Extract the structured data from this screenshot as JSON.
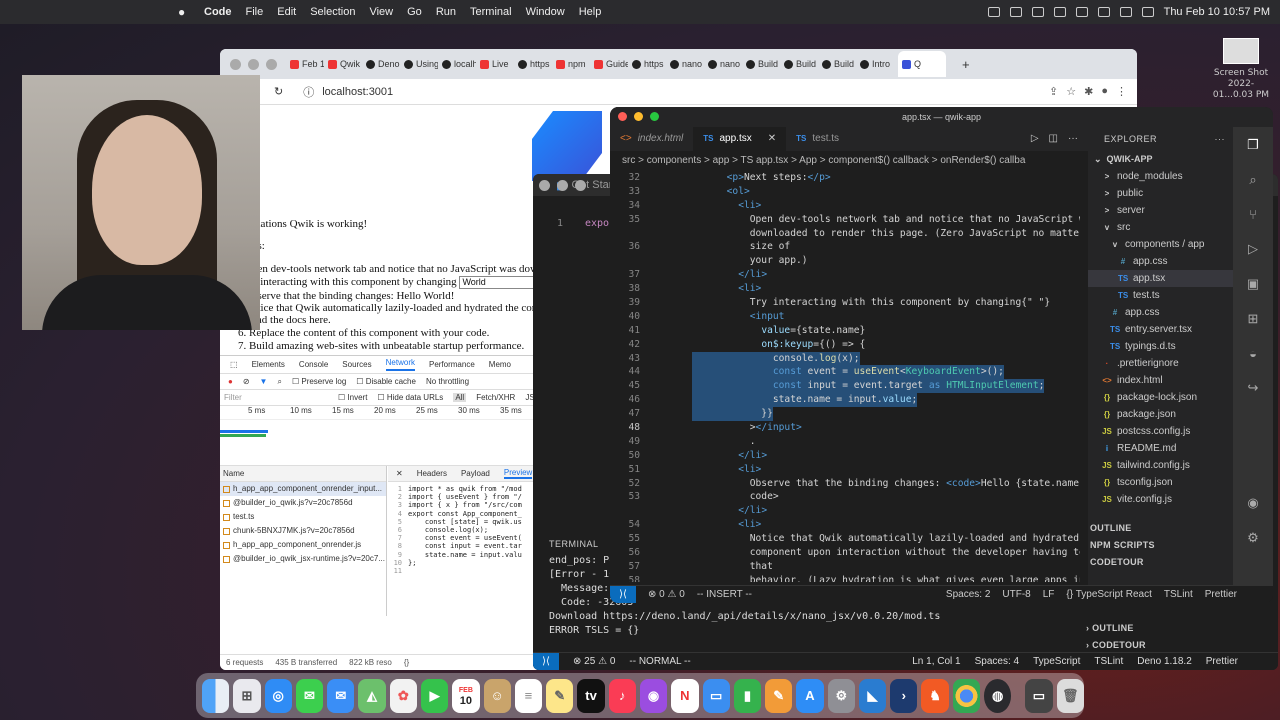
{
  "menubar": {
    "app": "Code",
    "items": [
      "File",
      "Edit",
      "Selection",
      "View",
      "Go",
      "Run",
      "Terminal",
      "Window",
      "Help"
    ],
    "clock": "Thu Feb 10  10:57 PM"
  },
  "desktop": {
    "screenshot_label": "Screen Shot",
    "screenshot_date": "2022-01...0.03 PM"
  },
  "browser": {
    "tabs": [
      "Feb 1",
      "Qwik",
      "Deno",
      "Using",
      "localh",
      "Live",
      "https",
      "npm",
      "Guide",
      "https",
      "nano",
      "nano",
      "Build",
      "Build",
      "Build",
      "Intro",
      "Q"
    ],
    "url": "localhost:3001",
    "page_lines": [
      "ulations Qwik is working!",
      "ps:",
      "pen dev-tools network tab and notice that no JavaScript was downl",
      "y interacting with this component by changing",
      "bserve that the binding changes: Hello World!",
      "otice that Qwik automatically lazily-loaded and hydrated the comp",
      "ead the docs here.",
      "6. Replace the content of this component with your code.",
      "7. Build amazing web-sites with unbeatable startup performance."
    ],
    "input_value": "World",
    "devtools": {
      "tabs": [
        "Elements",
        "Console",
        "Sources",
        "Network",
        "Performance",
        "Memo"
      ],
      "active_tab": "Network",
      "toolbar": [
        "Preserve log",
        "Disable cache",
        "No throttling"
      ],
      "filter_placeholder": "Filter",
      "filter_opts": [
        "Invert",
        "Hide data URLs",
        "All",
        "Fetch/XHR",
        "JS",
        "CS"
      ],
      "ticks": [
        "5 ms",
        "10 ms",
        "15 ms",
        "20 ms",
        "25 ms",
        "30 ms",
        "35 ms"
      ],
      "list_header": "Name",
      "requests": [
        "h_app_app_component_onrender_input...",
        "@builder_io_qwik.js?v=20c7856d",
        "test.ts",
        "chunk-5BNXJ7MK.js?v=20c7856d",
        "h_app_app_component_onrender.js",
        "@builder_io_qwik_jsx-runtime.js?v=20c7..."
      ],
      "preview_tabs": [
        "Headers",
        "Payload",
        "Preview"
      ],
      "active_preview": "Preview",
      "code_lines": [
        "import * as qwik from \"/mod",
        "import { useEvent } from \"/",
        "import { x } from \"/src/com",
        "export const App_component_",
        "    const [state] = qwik.us",
        "    console.log(x);",
        "    const event = useEvent(",
        "    const input = event.tar",
        "    state.name = input.valu",
        "};",
        ""
      ],
      "status": [
        "6 requests",
        "435 B transferred",
        "822 kB reso"
      ]
    }
  },
  "deno_window": {
    "title": "Get Started",
    "editor_line_no": "1",
    "editor_text": "expor",
    "terminal_label": "TERMINAL",
    "terminal_lines": [
      "end_pos: Po",
      "[Error - 10",
      "  Message:",
      "  Code: -32603",
      "Download https://deno.land/_api/details/x/nano_jsx/v0.0.20/mod.ts",
      "ERROR TSLS = {}"
    ],
    "status": {
      "errors": "25",
      "warnings": "0",
      "mode": "-- NORMAL --",
      "pos": "Ln 1, Col 1",
      "spaces": "Spaces: 4",
      "lang": "TypeScript",
      "lint": "TSLint",
      "deno": "Deno 1.18.2",
      "fmt": "Prettier"
    },
    "footer": [
      "OUTLINE",
      "CODETOUR"
    ]
  },
  "vscode": {
    "title": "app.tsx — qwik-app",
    "tabs": [
      {
        "icon": "<>",
        "label": "index.html"
      },
      {
        "icon": "TS",
        "label": "app.tsx"
      },
      {
        "icon": "TS",
        "label": "test.ts"
      }
    ],
    "breadcrumb": "src  >  components  >  app  >  TS app.tsx  >  App  >  component$() callback  >  onRender$() callba",
    "lines": [
      {
        "n": "32",
        "c": "      <p>Next steps:</p>"
      },
      {
        "n": "33",
        "c": "      <ol>"
      },
      {
        "n": "34",
        "c": "        <li>"
      },
      {
        "n": "35",
        "c": "          Open dev-tools network tab and notice that no JavaScript was"
      },
      {
        "n": "",
        "c": "          downloaded to render this page. (Zero JavaScript no matter the"
      },
      {
        "n": "36",
        "c": "          size of"
      },
      {
        "n": "",
        "c": "          your app.)"
      },
      {
        "n": "37",
        "c": "        </li>"
      },
      {
        "n": "38",
        "c": "        <li>"
      },
      {
        "n": "39",
        "c": "          Try interacting with this component by changing{\" \"}"
      },
      {
        "n": "40",
        "c": "          <input"
      },
      {
        "n": "41",
        "c": "            value={state.name}"
      },
      {
        "n": "42",
        "c": "            on$:keyup={() => {"
      },
      {
        "n": "43",
        "c": "              console.log(x);"
      },
      {
        "n": "44",
        "c": "              const event = useEvent<KeyboardEvent>();"
      },
      {
        "n": "45",
        "c": "              const input = event.target as HTMLInputElement;"
      },
      {
        "n": "46",
        "c": "              state.name = input.value;"
      },
      {
        "n": "47",
        "c": "            }}"
      },
      {
        "n": "48",
        "c": "          ></input>"
      },
      {
        "n": "49",
        "c": "          ."
      },
      {
        "n": "50",
        "c": "        </li>"
      },
      {
        "n": "51",
        "c": "        <li>"
      },
      {
        "n": "52",
        "c": "          Observe that the binding changes: <code>Hello {state.name}!</"
      },
      {
        "n": "53",
        "c": "          code>"
      },
      {
        "n": "",
        "c": "        </li>"
      },
      {
        "n": "54",
        "c": "        <li>"
      },
      {
        "n": "55",
        "c": "          Notice that Qwik automatically lazily-loaded and hydrated the"
      },
      {
        "n": "56",
        "c": "          component upon interaction without the developer having to code"
      },
      {
        "n": "57",
        "c": "          that"
      },
      {
        "n": "58",
        "c": "          behavior. (Lazy hydration is what gives even large apps instant"
      }
    ],
    "explorer": {
      "header": "EXPLORER",
      "project": "QWIK-APP",
      "items": [
        {
          "label": "node_modules",
          "icon": ">",
          "indent": 1
        },
        {
          "label": "public",
          "icon": ">",
          "indent": 1
        },
        {
          "label": "server",
          "icon": ">",
          "indent": 1
        },
        {
          "label": "src",
          "icon": "v",
          "indent": 1
        },
        {
          "label": "components / app",
          "icon": "v",
          "indent": 2
        },
        {
          "label": "app.css",
          "icon": "#",
          "indent": 3
        },
        {
          "label": "app.tsx",
          "icon": "TS",
          "indent": 3
        },
        {
          "label": "test.ts",
          "icon": "TS",
          "indent": 3
        },
        {
          "label": "app.css",
          "icon": "#",
          "indent": 2
        },
        {
          "label": "entry.server.tsx",
          "icon": "TS",
          "indent": 2
        },
        {
          "label": "typings.d.ts",
          "icon": "TS",
          "indent": 2
        },
        {
          "label": ".prettierignore",
          "icon": "·",
          "indent": 1
        },
        {
          "label": "index.html",
          "icon": "<>",
          "indent": 1
        },
        {
          "label": "package-lock.json",
          "icon": "{}",
          "indent": 1
        },
        {
          "label": "package.json",
          "icon": "{}",
          "indent": 1
        },
        {
          "label": "postcss.config.js",
          "icon": "JS",
          "indent": 1
        },
        {
          "label": "README.md",
          "icon": "i",
          "indent": 1
        },
        {
          "label": "tailwind.config.js",
          "icon": "JS",
          "indent": 1
        },
        {
          "label": "tsconfig.json",
          "icon": "{}",
          "indent": 1
        },
        {
          "label": "vite.config.js",
          "icon": "JS",
          "indent": 1
        }
      ],
      "sections": [
        "OUTLINE",
        "NPM SCRIPTS",
        "CODETOUR"
      ]
    },
    "status": {
      "errors": "0",
      "warnings": "0",
      "mode": "-- INSERT --",
      "spaces": "Spaces: 2",
      "enc": "UTF-8",
      "eol": "LF",
      "lang": "TypeScript React",
      "lint": "TSLint",
      "fmt": "Prettier"
    }
  },
  "dock": {
    "calendar_month": "FEB",
    "calendar_day": "10"
  }
}
